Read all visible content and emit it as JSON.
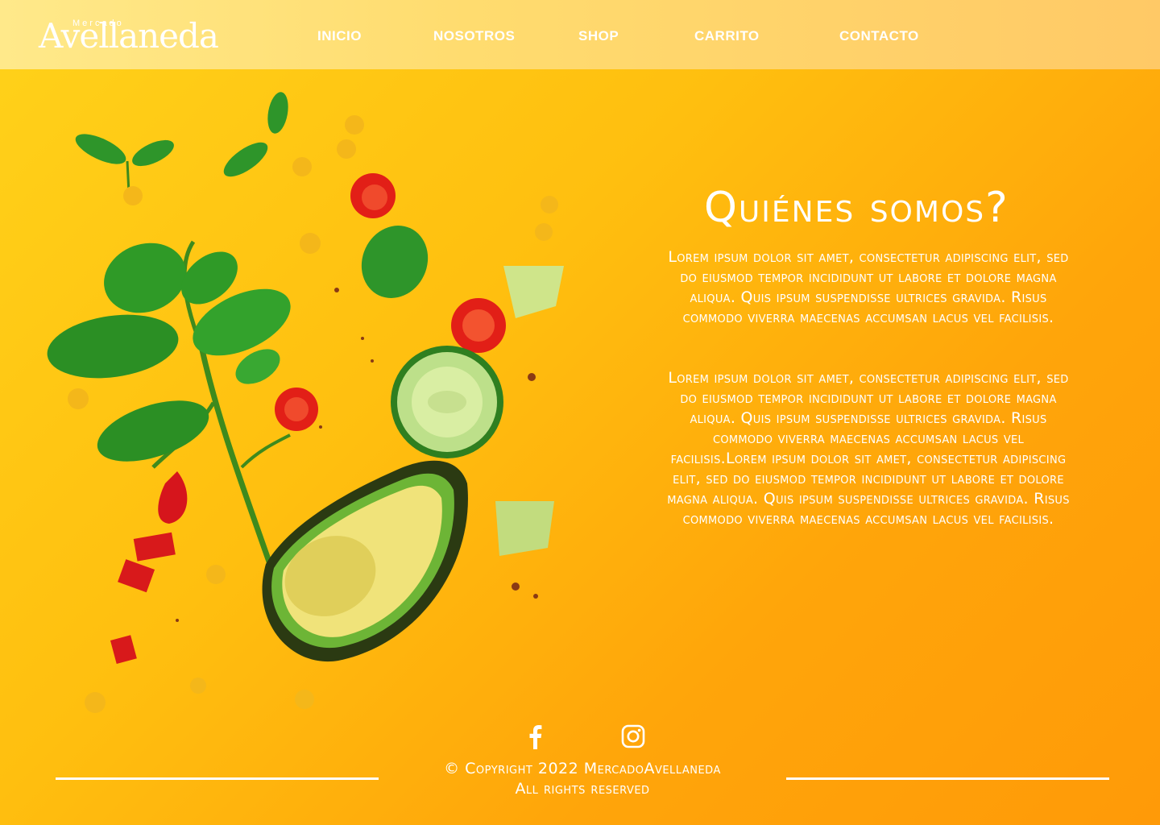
{
  "brand": {
    "small": "Mercado",
    "name": "Avellaneda"
  },
  "nav": {
    "items": [
      {
        "label": "INICIO"
      },
      {
        "label": "NOSOTROS"
      },
      {
        "label": "SHOP"
      },
      {
        "label": "CARRITO"
      },
      {
        "label": "CONTACTO"
      }
    ]
  },
  "hero": {
    "image": "vegetables-illustration"
  },
  "about": {
    "title": "Quiénes somos?",
    "paragraphs": [
      "Lorem ipsum dolor sit amet, consectetur adipiscing elit, sed do eiusmod tempor incididunt ut labore et dolore magna aliqua. Quis ipsum suspendisse ultrices gravida. Risus commodo viverra maecenas accumsan lacus vel facilisis.",
      "Lorem ipsum dolor sit amet, consectetur adipiscing elit, sed do eiusmod tempor incididunt ut labore et dolore magna aliqua. Quis ipsum suspendisse ultrices gravida. Risus commodo viverra maecenas accumsan lacus vel facilisis.Lorem ipsum dolor sit amet, consectetur adipiscing elit, sed do eiusmod tempor incididunt ut labore et dolore magna aliqua. Quis ipsum suspendisse ultrices gravida. Risus commodo viverra maecenas accumsan lacus vel facilisis."
    ]
  },
  "footer": {
    "social": [
      {
        "icon": "facebook-icon"
      },
      {
        "icon": "instagram-icon"
      }
    ],
    "copyright": "© Copyright 2022 MercadoAvellaneda",
    "rights": "All rights reserved"
  },
  "colors": {
    "background": "#ffb20c",
    "header": "#ffe27a",
    "text": "#ffffff"
  }
}
